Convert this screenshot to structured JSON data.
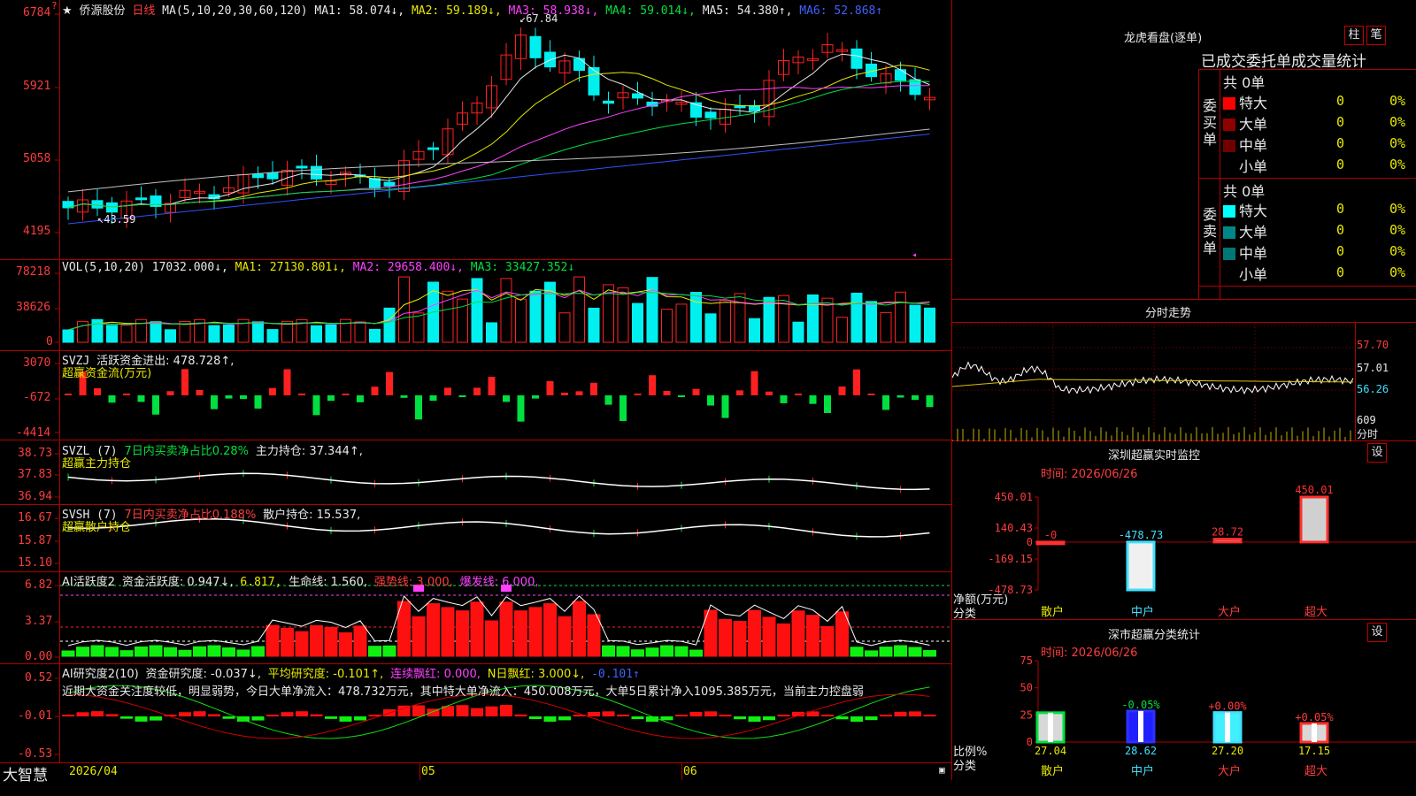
{
  "main": {
    "stock_name": "侨源股份",
    "period": "日线",
    "ma_line": {
      "params": "MA(5,10,20,30,60,120)",
      "ma1": "MA1: 58.074↓,",
      "ma2": "MA2: 59.189↓,",
      "ma3": "MA3: 58.938↓,",
      "ma4": "MA4: 59.014↓,",
      "ma5": "MA5: 54.380↑,",
      "ma6": "MA6: 52.868↑"
    },
    "y_ticks": [
      "6784",
      "5921",
      "5058",
      "4195"
    ],
    "high_label": "67.84",
    "low_label": "43.59"
  },
  "vol": {
    "legend": "VOL(5,10,20)",
    "value": "17032.000↓,",
    "ma1": "MA1: 27130.801↓,",
    "ma2": "MA2: 29658.400↓,",
    "ma3": "MA3: 33427.352↓",
    "y_ticks": [
      "78218",
      "38626",
      "0"
    ]
  },
  "svzj": {
    "legend": "SVZJ",
    "active": "活跃资金进出: 478.728↑,",
    "subtitle": "超赢资金流(万元)",
    "y_ticks": [
      "3070",
      "-672",
      "-4414"
    ]
  },
  "svzl": {
    "legend": "SVZL  (7)",
    "ratio": "7日内买卖净占比0.28%",
    "hold": "主力持仓: 37.344↑,",
    "subtitle": "超赢主力持仓",
    "y_ticks": [
      "38.73",
      "37.83",
      "36.94"
    ]
  },
  "svsh": {
    "legend": "SVSH  (7)",
    "ratio": "7日内买卖净占比0.188%",
    "hold": "散户持仓: 15.537,",
    "subtitle": "超赢散户持仓",
    "y_ticks": [
      "16.67",
      "15.87",
      "15.10"
    ]
  },
  "ai_active": {
    "legend": "AI活跃度2",
    "activity": "资金活跃度: 0.947↓,",
    "v2": "6.817,",
    "life": "生命线: 1.560,",
    "strong": "强势线: 3.000,",
    "burst": "爆发线: 6.000,",
    "y_ticks": [
      "6.82",
      "3.37",
      "0.00"
    ]
  },
  "ai_research": {
    "legend": "AI研究度2(10)",
    "research": "资金研究度: -0.037↓,",
    "avg": "平均研究度: -0.101↑,",
    "red_streak": "连续飘红: 0.000,",
    "n_red": "N日飘红: 3.000↓,",
    "last": "-0.101↑",
    "commentary": "近期大资金关注度较低，明显弱势，今日大单净流入：478.732万元，其中特大单净流入：450.008万元，大单5日累计净入1095.385万元，当前主力控盘弱",
    "y_ticks": [
      "0.52",
      "-0.01",
      "-0.53"
    ]
  },
  "bottom": {
    "brand": "大智慧",
    "date_start": "2026/04",
    "m5": "05",
    "m6": "06"
  },
  "dragon": {
    "title": "龙虎看盘(逐单)",
    "btn_bar": "柱",
    "btn_pen": "笔",
    "header": "已成交委托单成交量统计",
    "buy_label": "委买单",
    "sell_label": "委卖单",
    "buy_total": "共 0单",
    "sell_total": "共 0单",
    "rows": [
      {
        "name": "特大",
        "count": "0",
        "pct": "0%"
      },
      {
        "name": "大单",
        "count": "0",
        "pct": "0%"
      },
      {
        "name": "中单",
        "count": "0",
        "pct": "0%"
      },
      {
        "name": "小单",
        "count": "0",
        "pct": "0%"
      }
    ]
  },
  "intraday": {
    "title": "分时走势",
    "prices": [
      "57.70",
      "57.01",
      "56.26"
    ],
    "vol": "609",
    "unit": "分时"
  },
  "sz_monitor": {
    "title": "深圳超赢实时监控",
    "btn": "设",
    "time": "时间: 2026/06/26",
    "y_ticks": [
      "450.01",
      "140.43",
      "0",
      "-169.15",
      "-478.73"
    ],
    "y_caption": "净额(万元)",
    "x_caption": "分类",
    "categories": [
      "散户",
      "中户",
      "大户",
      "超大"
    ],
    "values": [
      0,
      -478.73,
      28.72,
      450.01
    ],
    "value_labels": [
      "-0",
      "-478.73",
      "28.72",
      "450.01"
    ]
  },
  "sz_class": {
    "title": "深市超赢分类统计",
    "btn": "设",
    "time": "时间: 2026/06/26",
    "y_ticks": [
      "75",
      "50",
      "25",
      "0"
    ],
    "y_caption": "比例%",
    "x_caption": "分类",
    "categories": [
      "散户",
      "中户",
      "大户",
      "超大"
    ],
    "values": [
      27.04,
      28.62,
      27.2,
      17.15
    ],
    "deltas": [
      "",
      "-0.05%",
      "+0.00%",
      "+0.05%"
    ]
  },
  "chart_data": [
    {
      "type": "bar",
      "title": "深圳超赢实时监控",
      "ylabel": "净额(万元)",
      "xlabel": "分类",
      "categories": [
        "散户",
        "中户",
        "大户",
        "超大"
      ],
      "values": [
        0,
        -478.73,
        28.72,
        450.01
      ],
      "ylim": [
        -478.73,
        450.01
      ]
    },
    {
      "type": "bar",
      "title": "深市超赢分类统计",
      "ylabel": "比例%",
      "xlabel": "分类",
      "categories": [
        "散户",
        "中户",
        "大户",
        "超大"
      ],
      "values": [
        27.04,
        28.62,
        27.2,
        17.15
      ],
      "ylim": [
        0,
        75
      ]
    }
  ],
  "colors": {
    "up": "#ff2020",
    "down": "#00f0f0",
    "border": "#b00000"
  }
}
